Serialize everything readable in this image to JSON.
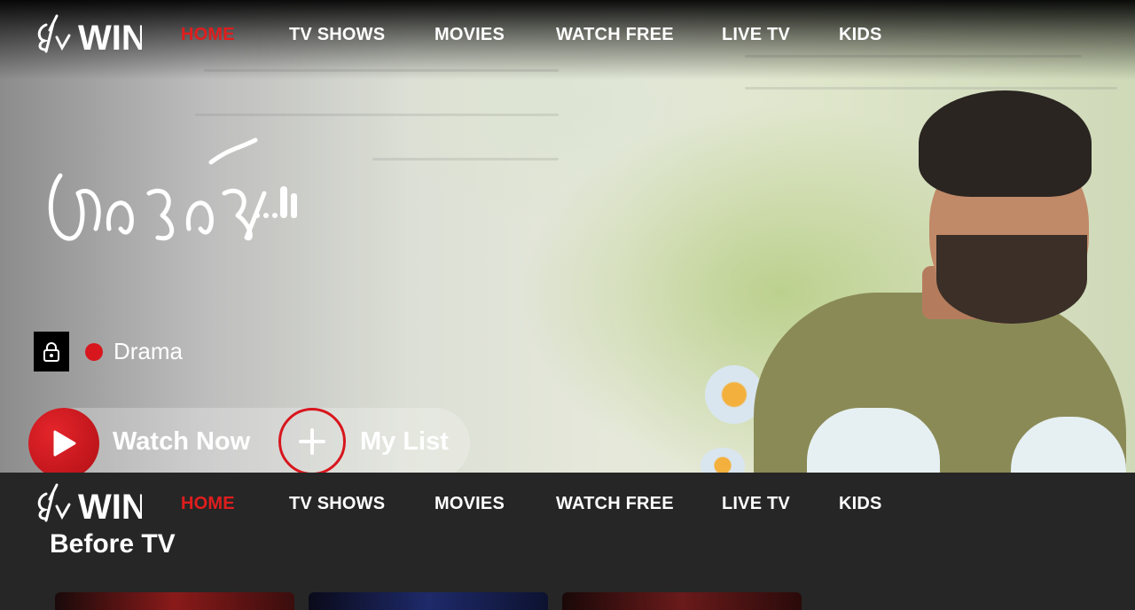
{
  "brand": {
    "logo_text": "WIN",
    "accent": "#e01d1d"
  },
  "nav": {
    "items": [
      {
        "label": "HOME",
        "active": true
      },
      {
        "label": "TV SHOWS",
        "active": false
      },
      {
        "label": "MOVIES",
        "active": false
      },
      {
        "label": "WATCH FREE",
        "active": false
      },
      {
        "label": "LIVE TV",
        "active": false
      },
      {
        "label": "KIDS",
        "active": false
      }
    ]
  },
  "hero": {
    "title_art": "అనగనగా...",
    "genre": "Drama",
    "lock_icon": "lock-icon",
    "watch_label": "Watch Now",
    "mylist_label": "My List"
  },
  "section": {
    "title": "Before TV"
  }
}
